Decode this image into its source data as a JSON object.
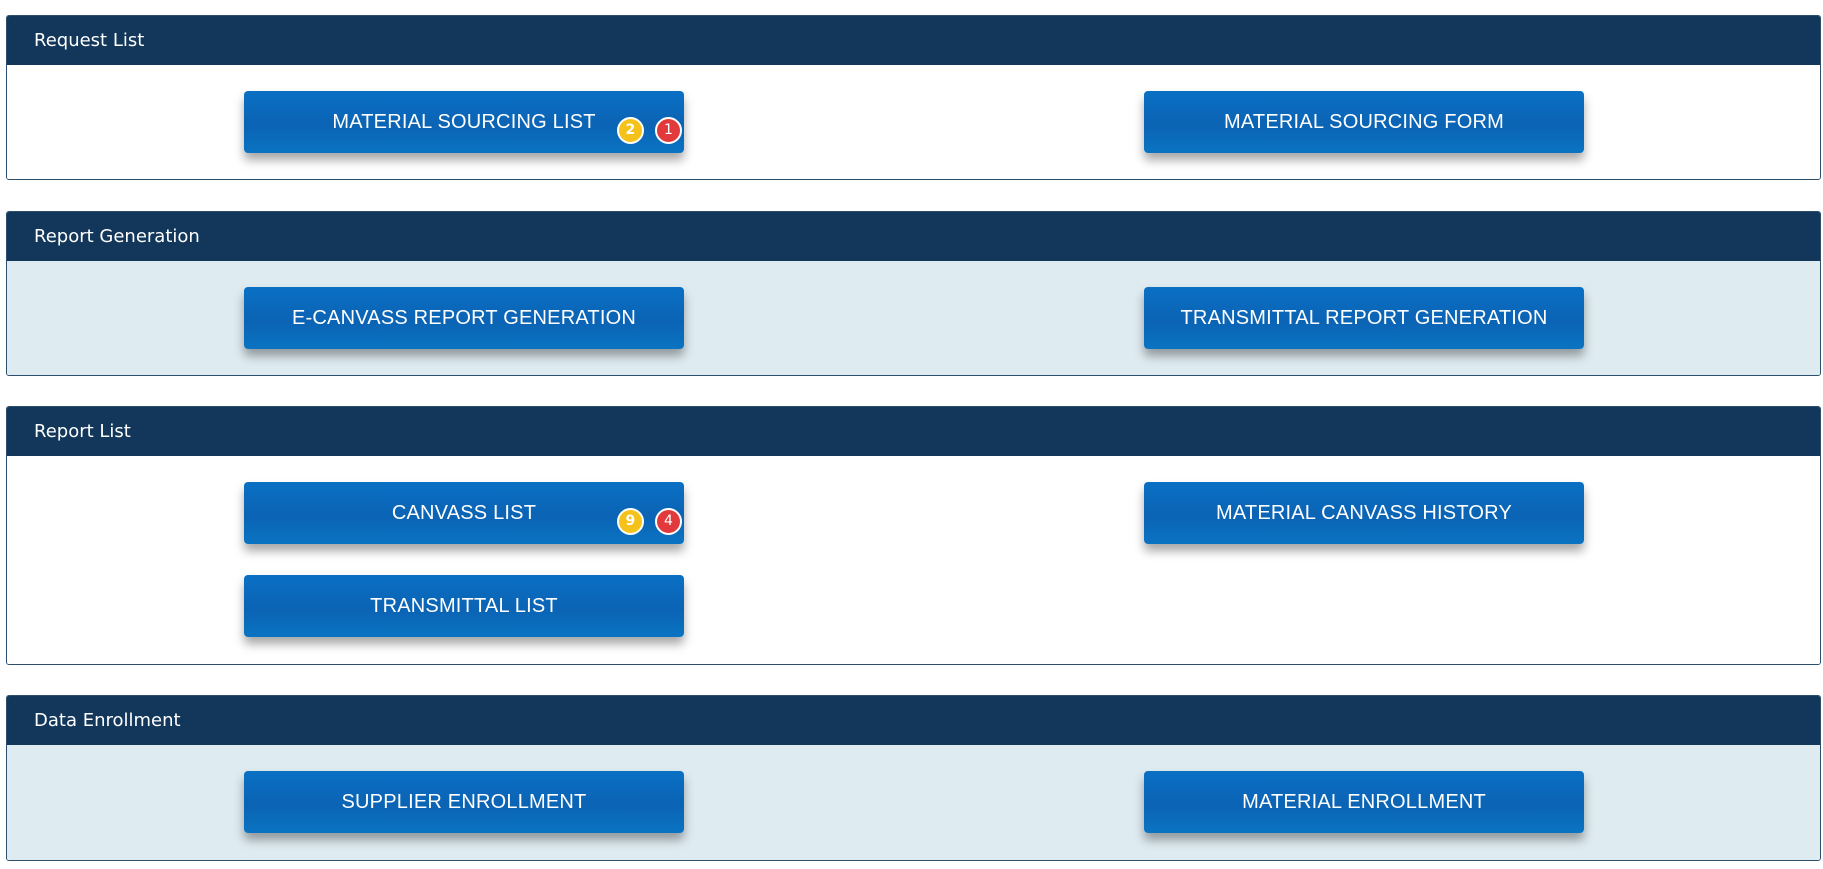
{
  "sections": [
    {
      "title": "Request List",
      "buttons": [
        {
          "label": "MATERIAL SOURCING LIST",
          "badges": [
            "2",
            "1"
          ]
        },
        {
          "label": "MATERIAL SOURCING FORM"
        }
      ]
    },
    {
      "title": "Report Generation",
      "buttons": [
        {
          "label": "E-CANVASS REPORT GENERATION"
        },
        {
          "label": "TRANSMITTAL REPORT GENERATION"
        }
      ]
    },
    {
      "title": "Report List",
      "buttons": [
        {
          "label": "CANVASS LIST",
          "badges": [
            "9",
            "4"
          ]
        },
        {
          "label": "MATERIAL CANVASS HISTORY"
        },
        {
          "label": "TRANSMITTAL LIST"
        }
      ]
    },
    {
      "title": "Data Enrollment",
      "buttons": [
        {
          "label": "SUPPLIER ENROLLMENT"
        },
        {
          "label": "MATERIAL ENROLLMENT"
        }
      ]
    }
  ],
  "colors": {
    "header": "#12375a",
    "button": "#0b6bbd",
    "badge_yellow": "#f4c21a",
    "badge_red": "#e23a3c",
    "panel_alt_bg": "#deebf1"
  }
}
